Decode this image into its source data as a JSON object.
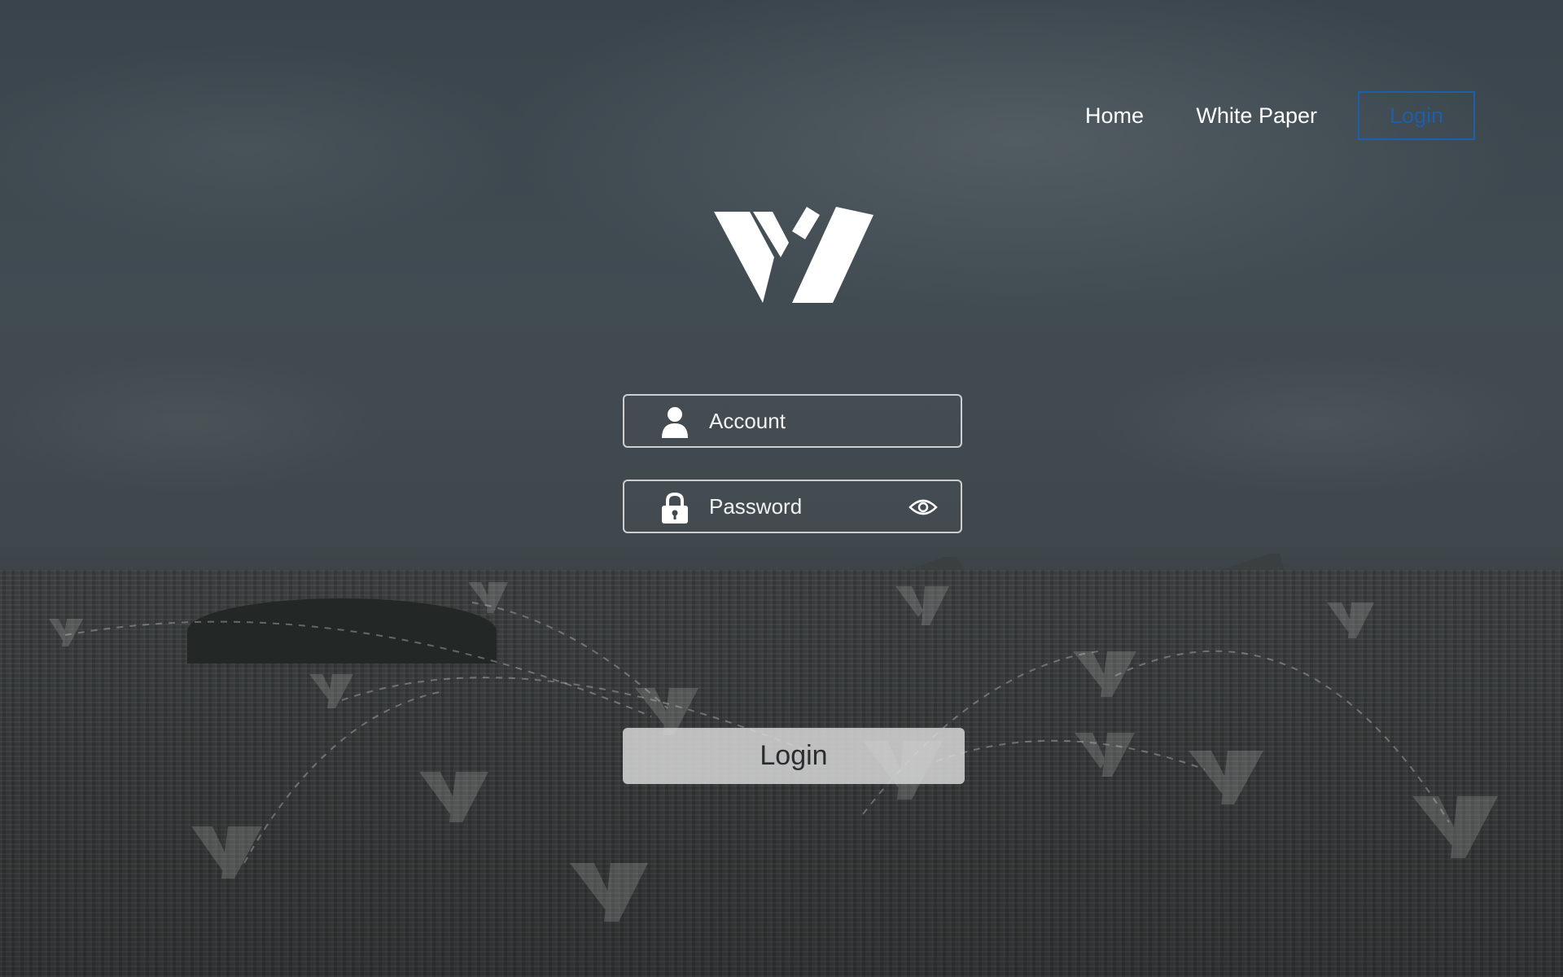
{
  "nav": {
    "home_label": "Home",
    "white_paper_label": "White Paper",
    "login_label": "Login"
  },
  "logo": {
    "icon": "w-brand-logo"
  },
  "form": {
    "account_placeholder": "Account",
    "password_placeholder": "Password",
    "submit_label": "Login"
  },
  "colors": {
    "accent": "#1d5fa8",
    "field_border": "#e6e6e6",
    "button_bg": "#d7d7d7",
    "text": "#ffffff"
  }
}
